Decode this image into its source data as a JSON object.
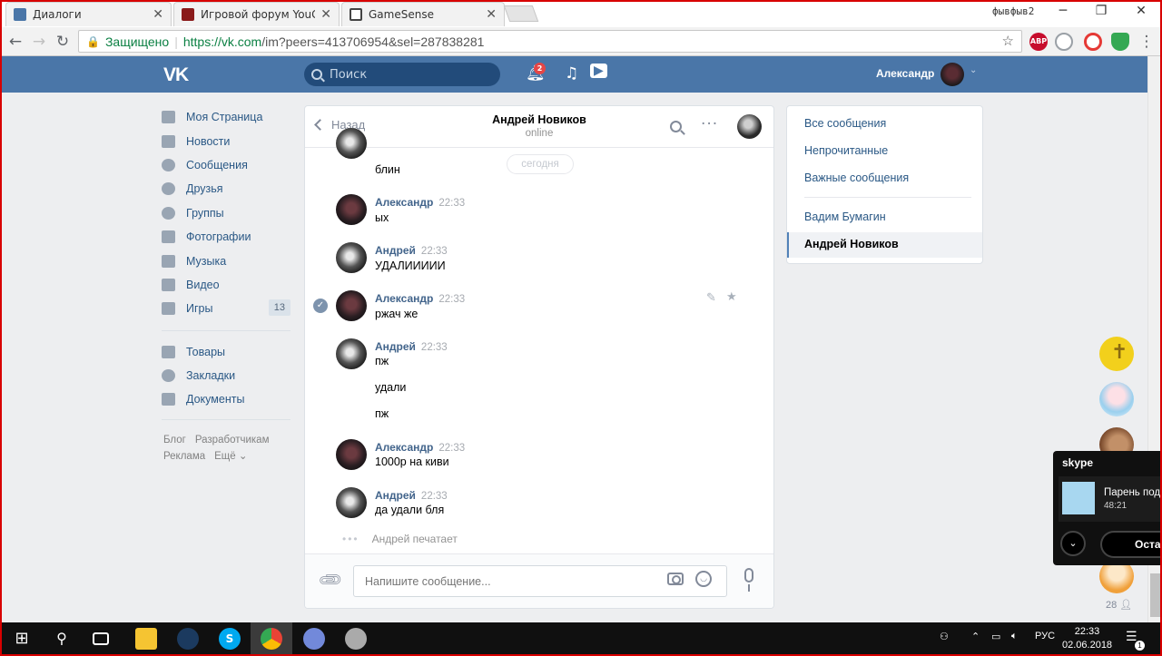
{
  "browser": {
    "tabs": [
      {
        "label": "Диалоги",
        "icon": "vk-icon",
        "color": "#4a76a8"
      },
      {
        "label": "Игровой форум YouGam",
        "icon": "yougame-icon",
        "color": "#8a1a1a"
      },
      {
        "label": "GameSense",
        "icon": "lock-icon",
        "color": "#444444"
      }
    ],
    "profile": "фывфыв2",
    "secure_label": "Защищено",
    "url_scheme": "https://",
    "url_host": "vk.com",
    "url_path": "/im?peers=413706954&sel=287838281",
    "extensions": [
      {
        "icon": "adblock-icon",
        "label": "ABP",
        "color": "#c70d2c"
      },
      {
        "icon": "shield-icon",
        "label": "",
        "color": "#9aa0a6"
      },
      {
        "icon": "opera-icon",
        "label": "",
        "color": "#e53935"
      },
      {
        "icon": "shield-check-icon",
        "label": "",
        "color": "#34a853"
      }
    ]
  },
  "vk": {
    "logo": "VK",
    "search_placeholder": "Поиск",
    "notifications_count": "2",
    "user_name": "Александр",
    "nav": [
      {
        "label": "Моя Страница",
        "icon": "home-icon"
      },
      {
        "label": "Новости",
        "icon": "news-icon"
      },
      {
        "label": "Сообщения",
        "icon": "messages-icon"
      },
      {
        "label": "Друзья",
        "icon": "friends-icon"
      },
      {
        "label": "Группы",
        "icon": "groups-icon"
      },
      {
        "label": "Фотографии",
        "icon": "camera-icon"
      },
      {
        "label": "Музыка",
        "icon": "music-icon"
      },
      {
        "label": "Видео",
        "icon": "video-icon"
      },
      {
        "label": "Игры",
        "icon": "gamepad-icon",
        "count": "13"
      }
    ],
    "nav2": [
      {
        "label": "Товары",
        "icon": "bag-icon"
      },
      {
        "label": "Закладки",
        "icon": "star-icon"
      },
      {
        "label": "Документы",
        "icon": "document-icon"
      }
    ],
    "footer": [
      "Блог",
      "Разработчикам",
      "Реклама",
      "Ещё ⌄"
    ]
  },
  "chat": {
    "back_label": "Назад",
    "peer_name": "Андрей Новиков",
    "peer_status": "online",
    "date_pill": "сегодня",
    "messages": [
      {
        "text": "блин"
      },
      {
        "author": "Александр",
        "time": "22:33",
        "lines": [
          "ых"
        ]
      },
      {
        "author": "Андрей",
        "time": "22:33",
        "lines": [
          "УДАЛИИИИИ"
        ]
      },
      {
        "author": "Александр",
        "time": "22:33",
        "lines": [
          "ржач же"
        ]
      },
      {
        "author": "Андрей",
        "time": "22:33",
        "lines": [
          "пж",
          "удали",
          "пж"
        ]
      },
      {
        "author": "Александр",
        "time": "22:33",
        "lines": [
          "1000р на киви"
        ]
      },
      {
        "author": "Андрей",
        "time": "22:33",
        "lines": [
          "да удали бля"
        ]
      }
    ],
    "typing": "Андрей печатает",
    "input_placeholder": "Напишите сообщение..."
  },
  "filters": {
    "items": [
      "Все сообщения",
      "Непрочитанные",
      "Важные сообщения"
    ],
    "dialogs": [
      "Вадим Бумагин",
      "Андрей Новиков"
    ]
  },
  "float": {
    "count": "28"
  },
  "skype": {
    "logo": "skype",
    "name": "Парень под",
    "time": "48:21",
    "button": "Оста"
  },
  "taskbar": {
    "lang": "РУС",
    "time": "22:33",
    "date": "02.06.2018",
    "notifications": "1"
  }
}
